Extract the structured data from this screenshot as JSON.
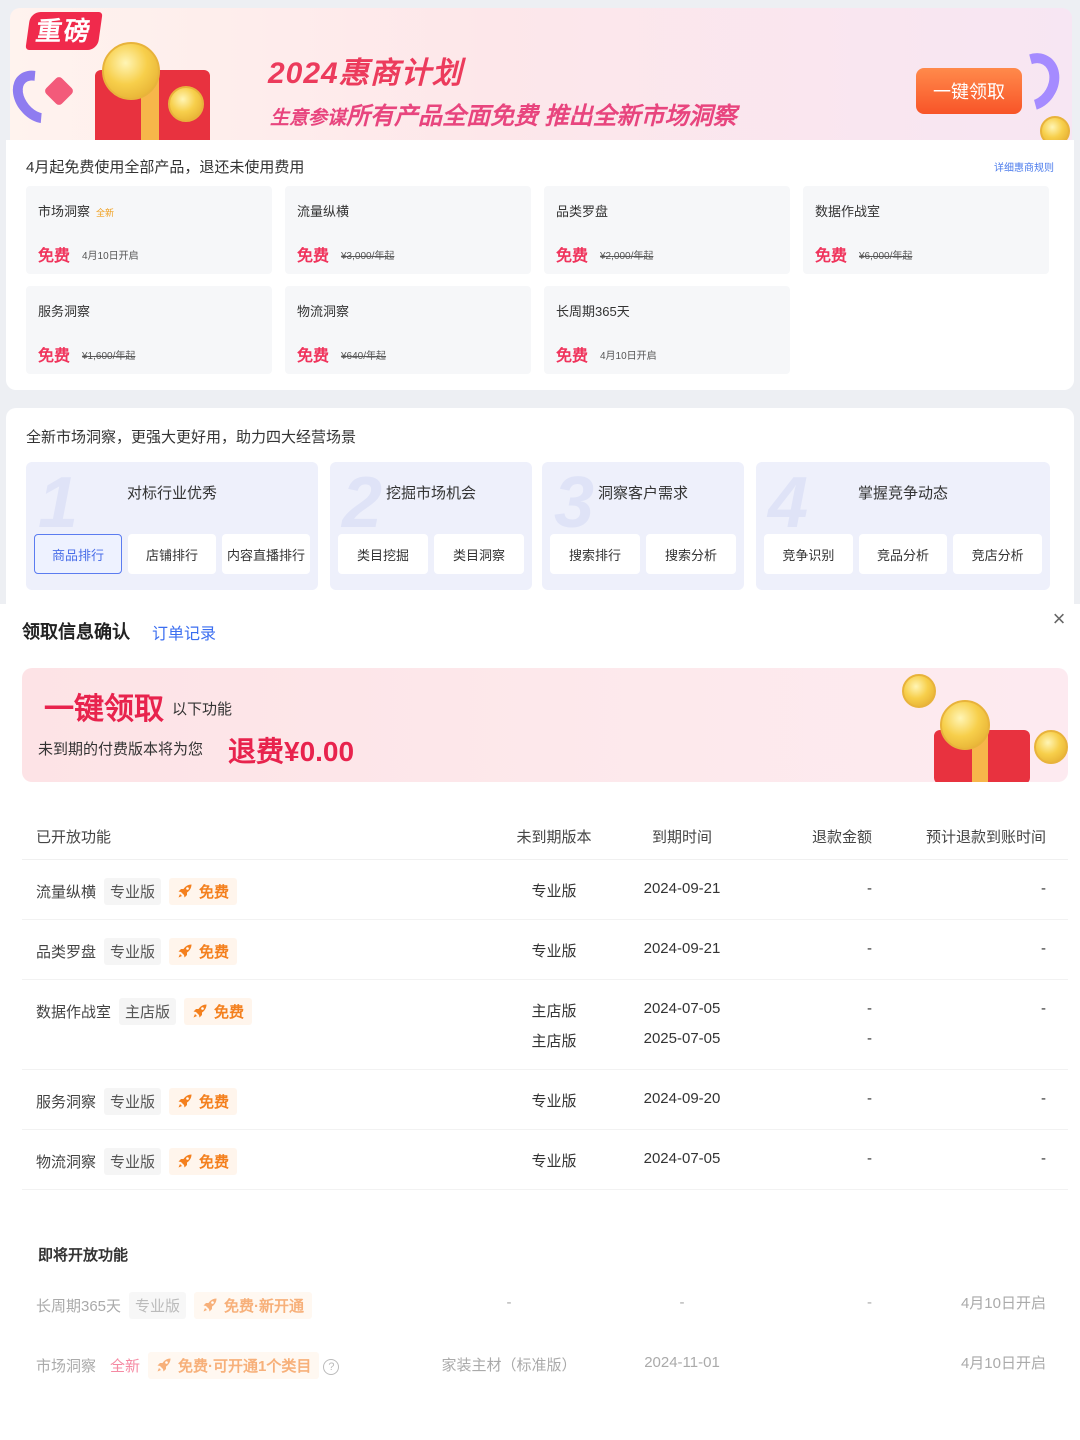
{
  "banner": {
    "tag": "重磅",
    "title": "2024惠商计划",
    "subtitle_small": "生意参谋",
    "subtitle_main": "所有产品全面免费 推出全新市场洞察",
    "claim_button": "一键领取"
  },
  "products_panel": {
    "title": "4月起免费使用全部产品，退还未使用费用",
    "rules_link": "详细惠商规则",
    "cards": [
      {
        "name": "市场洞察",
        "tag": "全新",
        "free": "免费",
        "price": "4月10日开启",
        "strike": false
      },
      {
        "name": "流量纵横",
        "tag": "",
        "free": "免费",
        "price": "¥3,000/年起",
        "strike": true
      },
      {
        "name": "品类罗盘",
        "tag": "",
        "free": "免费",
        "price": "¥2,000/年起",
        "strike": true
      },
      {
        "name": "数据作战室",
        "tag": "",
        "free": "免费",
        "price": "¥6,000/年起",
        "strike": true
      },
      {
        "name": "服务洞察",
        "tag": "",
        "free": "免费",
        "price": "¥1,600/年起",
        "strike": true
      },
      {
        "name": "物流洞察",
        "tag": "",
        "free": "免费",
        "price": "¥640/年起",
        "strike": true
      },
      {
        "name": "长周期365天",
        "tag": "",
        "free": "免费",
        "price": "4月10日开启",
        "strike": false
      }
    ]
  },
  "scenes_panel": {
    "title": "全新市场洞察，更强大更好用，助力四大经营场景",
    "scenes": [
      {
        "num": "1",
        "title": "对标行业优秀",
        "buttons": [
          "商品排行",
          "店铺排行",
          "内容直播排行"
        ]
      },
      {
        "num": "2",
        "title": "挖掘市场机会",
        "buttons": [
          "类目挖掘",
          "类目洞察"
        ]
      },
      {
        "num": "3",
        "title": "洞察客户需求",
        "buttons": [
          "搜索排行",
          "搜索分析"
        ]
      },
      {
        "num": "4",
        "title": "掌握竞争动态",
        "buttons": [
          "竞争识别",
          "竞品分析",
          "竞店分析"
        ]
      }
    ]
  },
  "modal": {
    "title": "领取信息确认",
    "order_link": "订单记录",
    "close": "×",
    "promo": {
      "big": "一键领取",
      "small": "以下功能",
      "line": "未到期的付费版本将为您",
      "amount": "退费¥0.00"
    },
    "headers": {
      "feature": "已开放功能",
      "version": "未到期版本",
      "expiry": "到期时间",
      "refund": "退款金额",
      "arrival": "预计退款到账时间"
    },
    "rows": [
      {
        "name": "流量纵横",
        "badge": "专业版",
        "free": "免费",
        "versions": [
          "专业版"
        ],
        "dates": [
          "2024-09-21"
        ],
        "refunds": [
          "-"
        ],
        "arrival": "-"
      },
      {
        "name": "品类罗盘",
        "badge": "专业版",
        "free": "免费",
        "versions": [
          "专业版"
        ],
        "dates": [
          "2024-09-21"
        ],
        "refunds": [
          "-"
        ],
        "arrival": "-"
      },
      {
        "name": "数据作战室",
        "badge": "主店版",
        "free": "免费",
        "versions": [
          "主店版",
          "主店版"
        ],
        "dates": [
          "2024-07-05",
          "2025-07-05"
        ],
        "refunds": [
          "-",
          "-"
        ],
        "arrival": "-"
      },
      {
        "name": "服务洞察",
        "badge": "专业版",
        "free": "免费",
        "versions": [
          "专业版"
        ],
        "dates": [
          "2024-09-20"
        ],
        "refunds": [
          "-"
        ],
        "arrival": "-"
      },
      {
        "name": "物流洞察",
        "badge": "专业版",
        "free": "免费",
        "versions": [
          "专业版"
        ],
        "dates": [
          "2024-07-05"
        ],
        "refunds": [
          "-"
        ],
        "arrival": "-"
      }
    ],
    "upcoming_title": "即将开放功能",
    "upcoming": [
      {
        "name": "长周期365天",
        "badge": "专业版",
        "free": "免费·新开通",
        "version": "-",
        "date": "-",
        "refund": "-",
        "arrival": "4月10日开启"
      },
      {
        "name": "市场洞察",
        "badge": "全新",
        "free": "免费·可开通1个类目",
        "help": "?",
        "version": "家装主材（标准版）",
        "date": "2024-11-01",
        "refund": "",
        "arrival": "4月10日开启"
      }
    ]
  },
  "colors": {
    "accent_red": "#e8234d",
    "free_orange": "#f4801e",
    "link_blue": "#3b6ef0",
    "claim_orange": "#f85428"
  }
}
